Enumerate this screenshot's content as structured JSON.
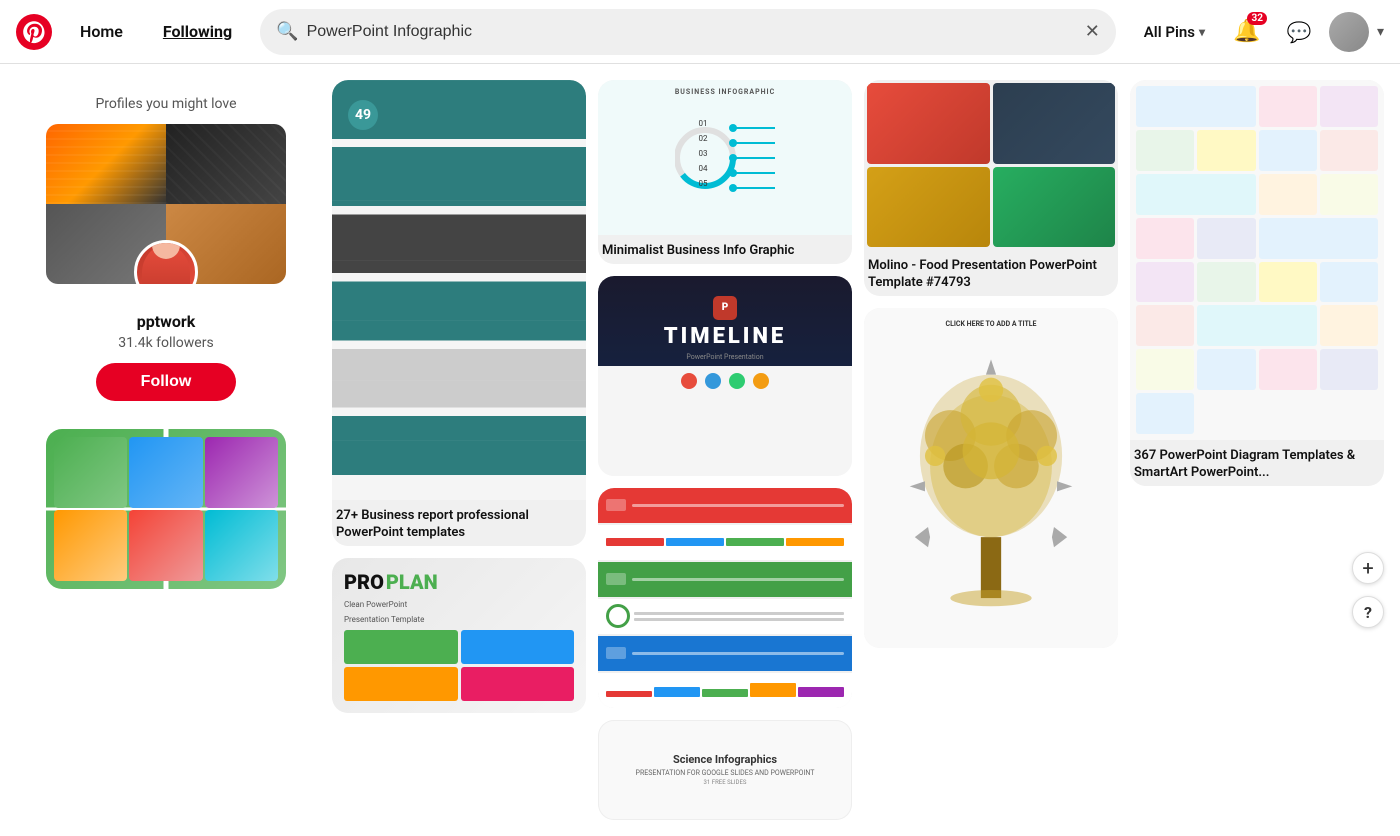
{
  "header": {
    "home_label": "Home",
    "following_label": "Following",
    "search_value": "PowerPoint Infographic",
    "search_placeholder": "Search",
    "all_pins_label": "All Pins",
    "notif_count": "32",
    "chevron_symbol": "▾"
  },
  "sidebar": {
    "section_title": "Profiles you might love",
    "profile": {
      "name": "pptwork",
      "followers": "31.4k followers",
      "follow_label": "Follow"
    }
  },
  "pins": {
    "col1": {
      "pin1": {
        "label": "27+ Business report professional PowerPoint templates"
      },
      "pin2": {
        "label": ""
      }
    },
    "col2": {
      "pin1": {
        "label": "Minimalist Business Info Graphic"
      },
      "pin2": {
        "label": ""
      },
      "pin3": {
        "label": "Science Infographics"
      }
    },
    "col3": {
      "pin1": {
        "label": "Molino - Food Presentation PowerPoint Template #74793"
      },
      "pin2": {
        "label": ""
      }
    },
    "col4": {
      "pin1": {
        "label": "367 PowerPoint Diagram Templates & SmartArt PowerPoint..."
      }
    }
  },
  "fab": {
    "add_label": "+",
    "help_label": "?"
  }
}
